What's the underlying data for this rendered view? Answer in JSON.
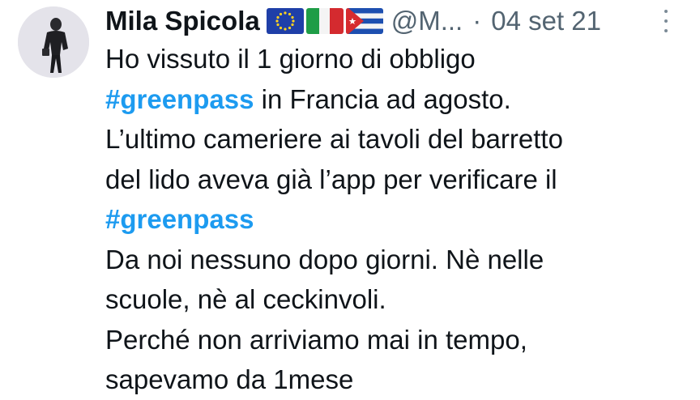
{
  "author": {
    "display_name": "Mila Spicola",
    "handle": "@M...",
    "separator": "·",
    "date": "04 set 21",
    "flags": [
      "eu-flag-icon",
      "italy-flag-icon",
      "cuba-flag-icon"
    ]
  },
  "tweet": {
    "lines": [
      {
        "text": "Ho vissuto il 1 giorno di obbligo"
      },
      {
        "hashtag": "#greenpass",
        "text": " in Francia ad agosto."
      },
      {
        "text": "L’ultimo cameriere ai tavoli del barretto"
      },
      {
        "text": "del lido aveva già l’app per verificare il"
      },
      {
        "hashtag": "#greenpass"
      },
      {
        "text": "Da noi nessuno dopo giorni. Nè nelle"
      },
      {
        "text": "scuole, nè al ceckinvoli."
      },
      {
        "text": "Perché non arriviamo mai in tempo,"
      },
      {
        "text": "sapevamo da 1mese"
      }
    ]
  },
  "colors": {
    "text": "#0f1419",
    "secondary": "#536471",
    "link": "#1d9bf0"
  }
}
